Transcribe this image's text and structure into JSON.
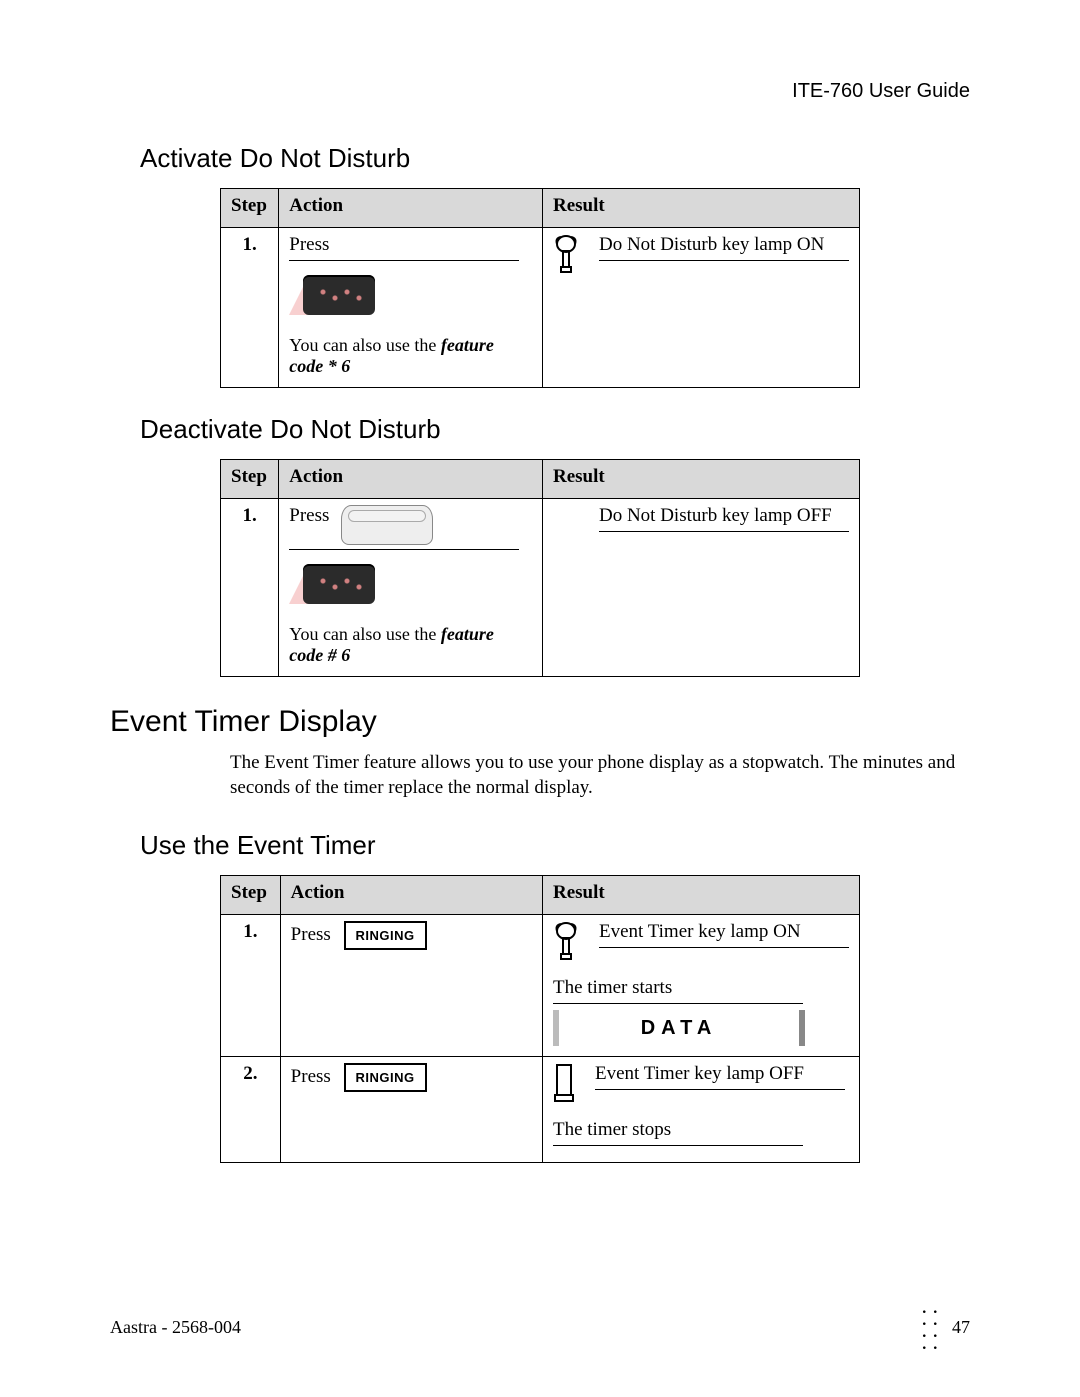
{
  "header": {
    "doc_title": "ITE-760 User Guide"
  },
  "sections": {
    "activate_dnd": {
      "title": "Activate Do Not Disturb",
      "table": {
        "headers": {
          "step": "Step",
          "action": "Action",
          "result": "Result"
        },
        "row1": {
          "step": "1.",
          "press": "Press",
          "note_pre": "You can also use the ",
          "note_em": "feature code * 6",
          "result_text": "Do Not Disturb key lamp ON"
        }
      }
    },
    "deactivate_dnd": {
      "title": "Deactivate Do Not Disturb",
      "table": {
        "headers": {
          "step": "Step",
          "action": "Action",
          "result": "Result"
        },
        "row1": {
          "step": "1.",
          "press": "Press",
          "note_pre": "You can also use the ",
          "note_em": "feature code # 6",
          "result_text": "Do Not Disturb key lamp OFF"
        }
      }
    },
    "event_timer": {
      "title": "Event Timer Display",
      "description": "The Event Timer feature allows you to use your phone display as a stopwatch.  The minutes and seconds of the timer replace the normal display."
    },
    "use_event_timer": {
      "title": "Use the Event Timer",
      "table": {
        "headers": {
          "step": "Step",
          "action": "Action",
          "result": "Result"
        },
        "row1": {
          "step": "1.",
          "press": "Press",
          "button_label": "RINGING",
          "result_lamp": "Event Timer key lamp ON",
          "result_text": "The timer starts",
          "lcd_text": "DATA"
        },
        "row2": {
          "step": "2.",
          "press": "Press",
          "button_label": "RINGING",
          "result_lamp": "Event Timer key lamp OFF",
          "result_text": "The timer stops"
        }
      }
    }
  },
  "footer": {
    "left": "Aastra - 2568-004",
    "page": "47"
  }
}
